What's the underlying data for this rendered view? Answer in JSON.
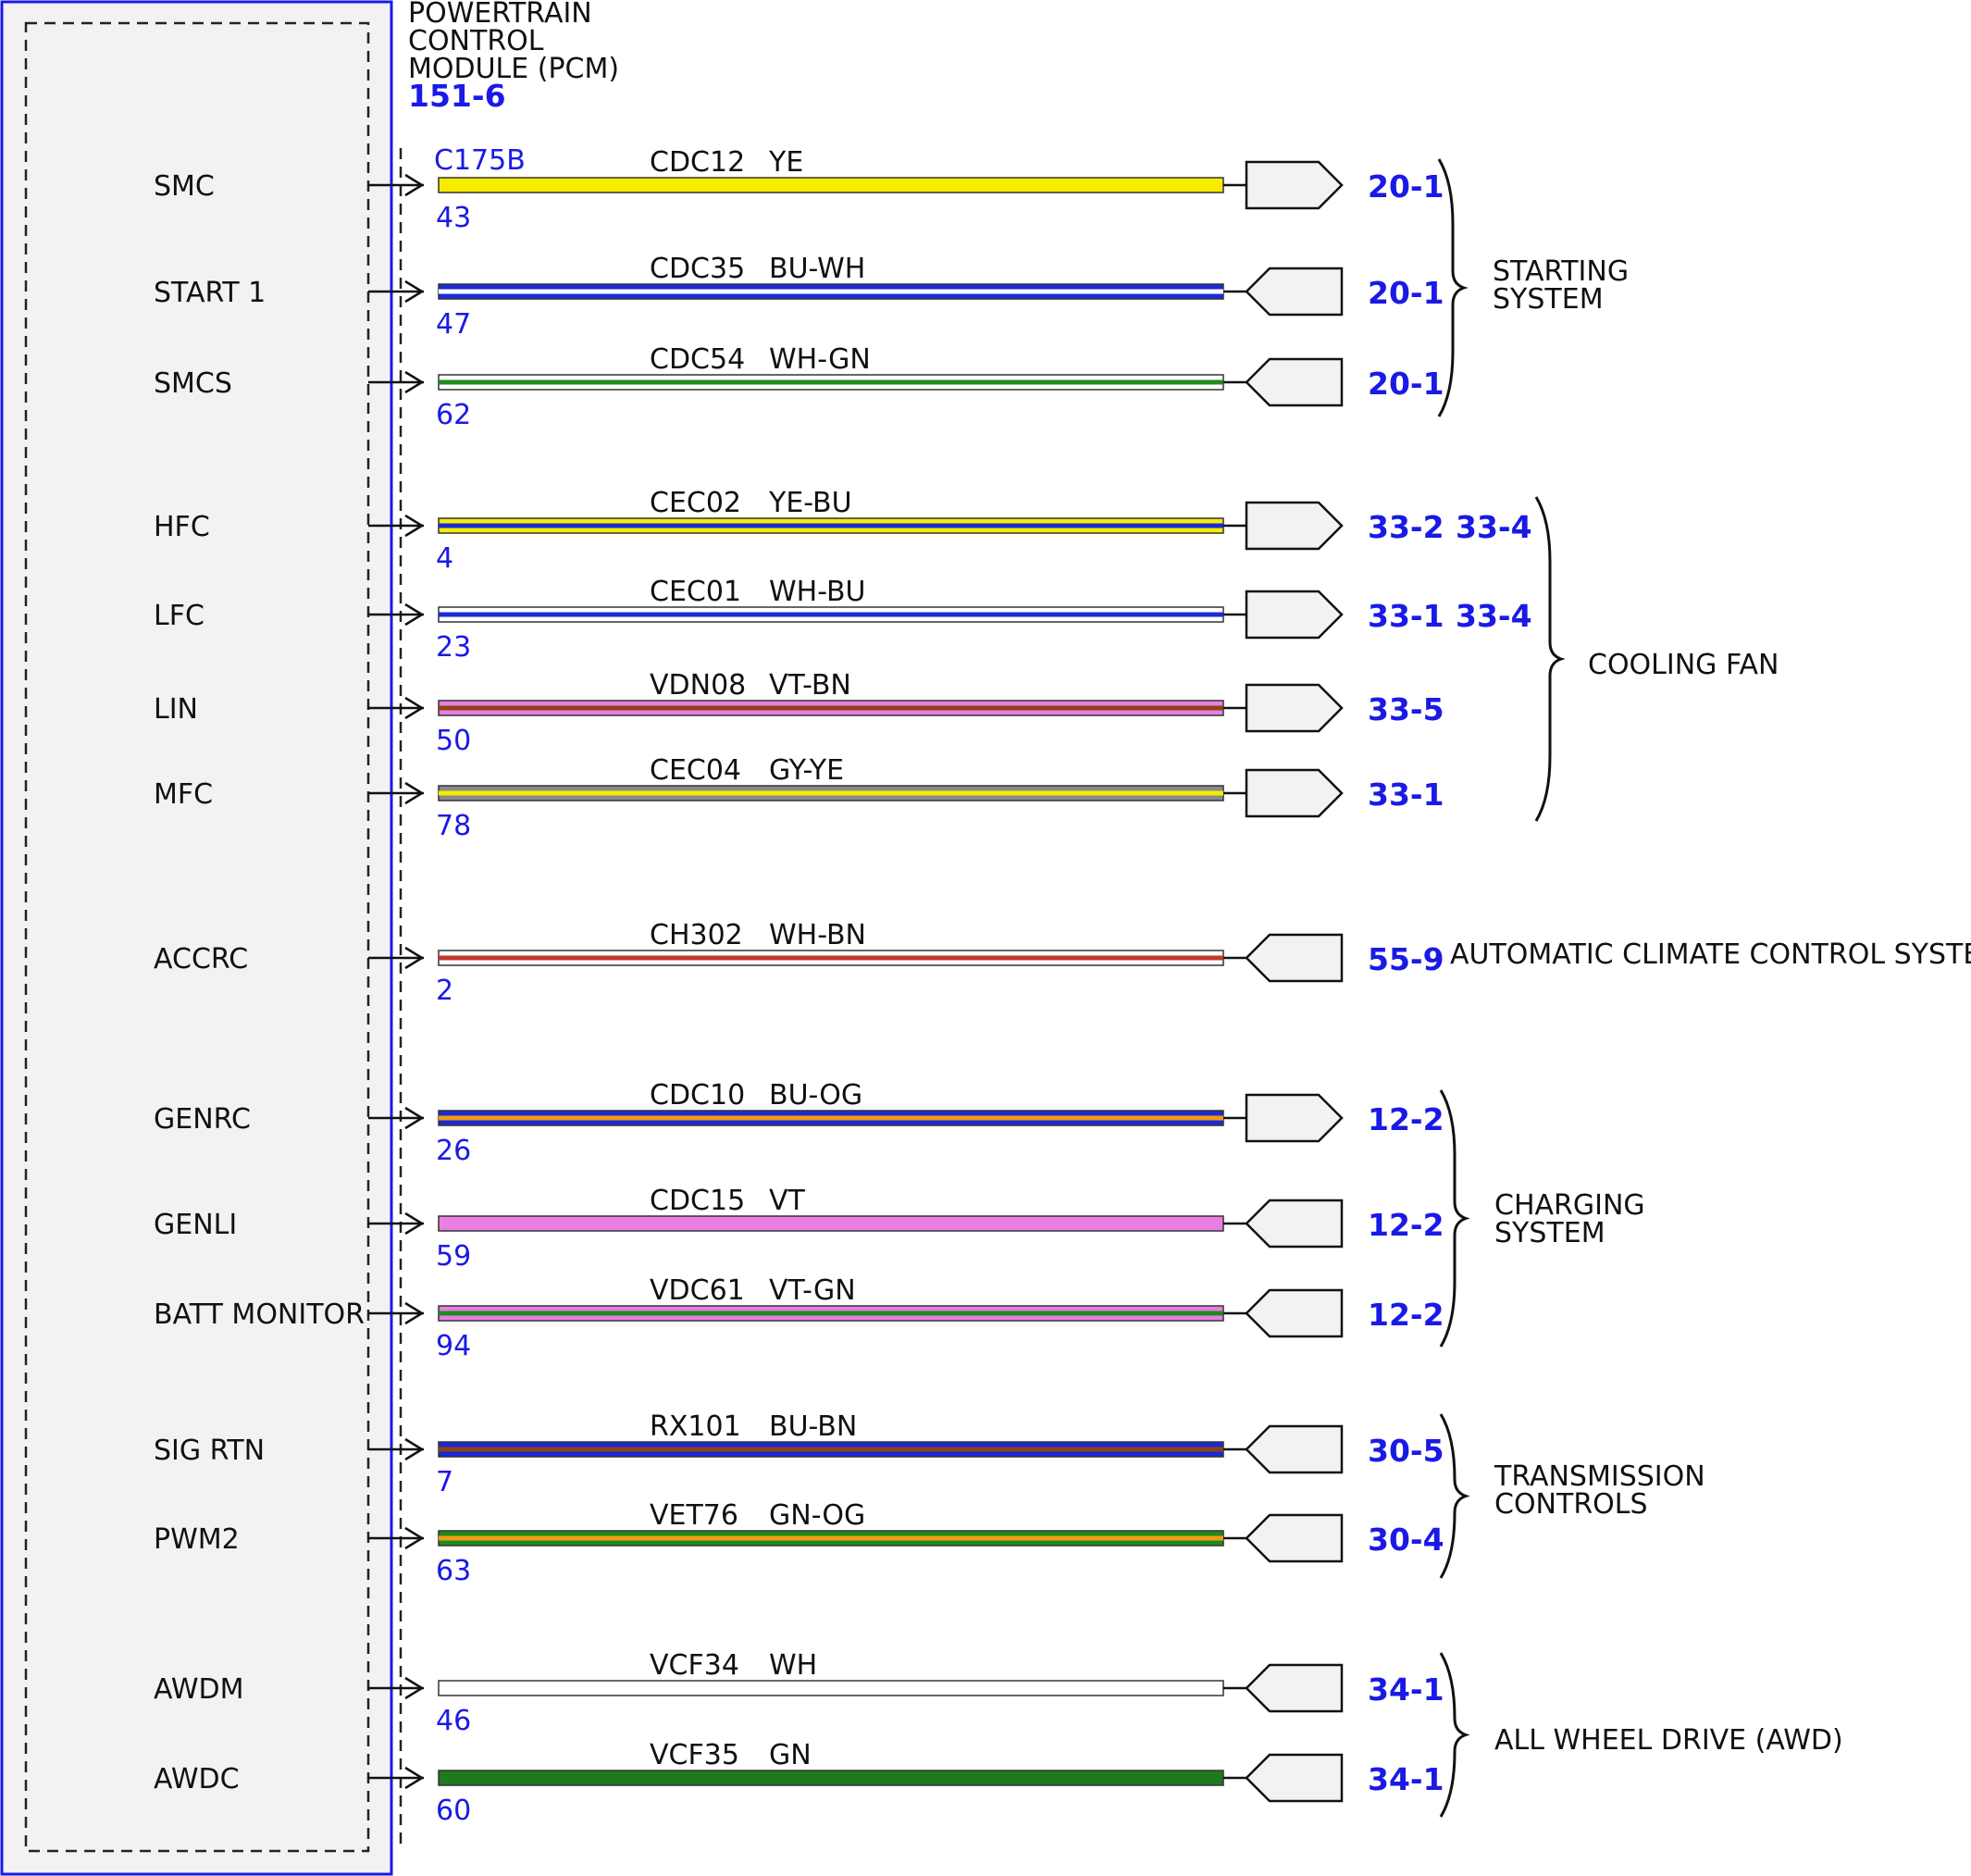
{
  "module": {
    "title_lines": [
      "POWERTRAIN",
      "CONTROL",
      "MODULE (PCM)"
    ],
    "ref": "151-6",
    "connector": "C175B"
  },
  "circuits": [
    {
      "signal": "SMC",
      "pin": "43",
      "circuit": "CDC12",
      "color": "YE",
      "wire": [
        "#f5ec00",
        "#f5ec00"
      ],
      "dir": "out",
      "refs": [
        "20-1"
      ]
    },
    {
      "signal": "START 1",
      "pin": "47",
      "circuit": "CDC35",
      "color": "BU-WH",
      "wire": [
        "#1a2bd6",
        "#ffffff"
      ],
      "dir": "in",
      "refs": [
        "20-1"
      ]
    },
    {
      "signal": "SMCS",
      "pin": "62",
      "circuit": "CDC54",
      "color": "WH-GN",
      "wire": [
        "#ffffff",
        "#1e8a1e"
      ],
      "dir": "in",
      "refs": [
        "20-1"
      ]
    },
    {
      "signal": "HFC",
      "pin": "4",
      "circuit": "CEC02",
      "color": "YE-BU",
      "wire": [
        "#f5ec00",
        "#1a2bd6"
      ],
      "dir": "out",
      "refs": [
        "33-2",
        "33-4"
      ]
    },
    {
      "signal": "LFC",
      "pin": "23",
      "circuit": "CEC01",
      "color": "WH-BU",
      "wire": [
        "#ffffff",
        "#1a2bd6"
      ],
      "dir": "out",
      "refs": [
        "33-1",
        "33-4"
      ]
    },
    {
      "signal": "LIN",
      "pin": "50",
      "circuit": "VDN08",
      "color": "VT-BN",
      "wire": [
        "#ea7ee2",
        "#8b4513"
      ],
      "dir": "out",
      "refs": [
        "33-5"
      ]
    },
    {
      "signal": "MFC",
      "pin": "78",
      "circuit": "CEC04",
      "color": "GY-YE",
      "wire": [
        "#8a8a8a",
        "#f5ec00"
      ],
      "dir": "out",
      "refs": [
        "33-1"
      ]
    },
    {
      "signal": "ACCRC",
      "pin": "2",
      "circuit": "CH302",
      "color": "WH-BN",
      "wire": [
        "#ffffff",
        "#c0392b"
      ],
      "dir": "in",
      "refs": [
        "55-9"
      ]
    },
    {
      "signal": "GENRC",
      "pin": "26",
      "circuit": "CDC10",
      "color": "BU-OG",
      "wire": [
        "#1a2bd6",
        "#f39c12"
      ],
      "dir": "out",
      "refs": [
        "12-2"
      ]
    },
    {
      "signal": "GENLI",
      "pin": "59",
      "circuit": "CDC15",
      "color": "VT",
      "wire": [
        "#ea7ee2",
        "#ea7ee2"
      ],
      "dir": "in",
      "refs": [
        "12-2"
      ]
    },
    {
      "signal": "BATT MONITOR",
      "pin": "94",
      "circuit": "VDC61",
      "color": "VT-GN",
      "wire": [
        "#ea7ee2",
        "#1e8a1e"
      ],
      "dir": "in",
      "refs": [
        "12-2"
      ]
    },
    {
      "signal": "SIG RTN",
      "pin": "7",
      "circuit": "RX101",
      "color": "BU-BN",
      "wire": [
        "#1a2bd6",
        "#8b4513"
      ],
      "dir": "in",
      "refs": [
        "30-5"
      ]
    },
    {
      "signal": "PWM2",
      "pin": "63",
      "circuit": "VET76",
      "color": "GN-OG",
      "wire": [
        "#1e8a1e",
        "#f39c12"
      ],
      "dir": "in",
      "refs": [
        "30-4"
      ]
    },
    {
      "signal": "AWDM",
      "pin": "46",
      "circuit": "VCF34",
      "color": "WH",
      "wire": [
        "#ffffff",
        "#ffffff"
      ],
      "dir": "in",
      "refs": [
        "34-1"
      ]
    },
    {
      "signal": "AWDC",
      "pin": "60",
      "circuit": "VCF35",
      "color": "GN",
      "wire": [
        "#1e7a1e",
        "#1e7a1e"
      ],
      "dir": "in",
      "refs": [
        "34-1"
      ]
    }
  ],
  "groups": [
    {
      "lines": [
        "STARTING",
        "SYSTEM"
      ]
    },
    {
      "lines": [
        "COOLING FAN"
      ]
    },
    {
      "lines": [
        "AUTOMATIC CLIMATE CONTROL SYSTEM"
      ]
    },
    {
      "lines": [
        "CHARGING",
        "SYSTEM"
      ]
    },
    {
      "lines": [
        "TRANSMISSION",
        "CONTROLS"
      ]
    },
    {
      "lines": [
        "ALL WHEEL DRIVE (AWD)"
      ]
    }
  ],
  "colors": {
    "module_border": "#1a1ae6",
    "text_blue": "#1a1ae6",
    "module_fill": "#f2f2f2"
  }
}
